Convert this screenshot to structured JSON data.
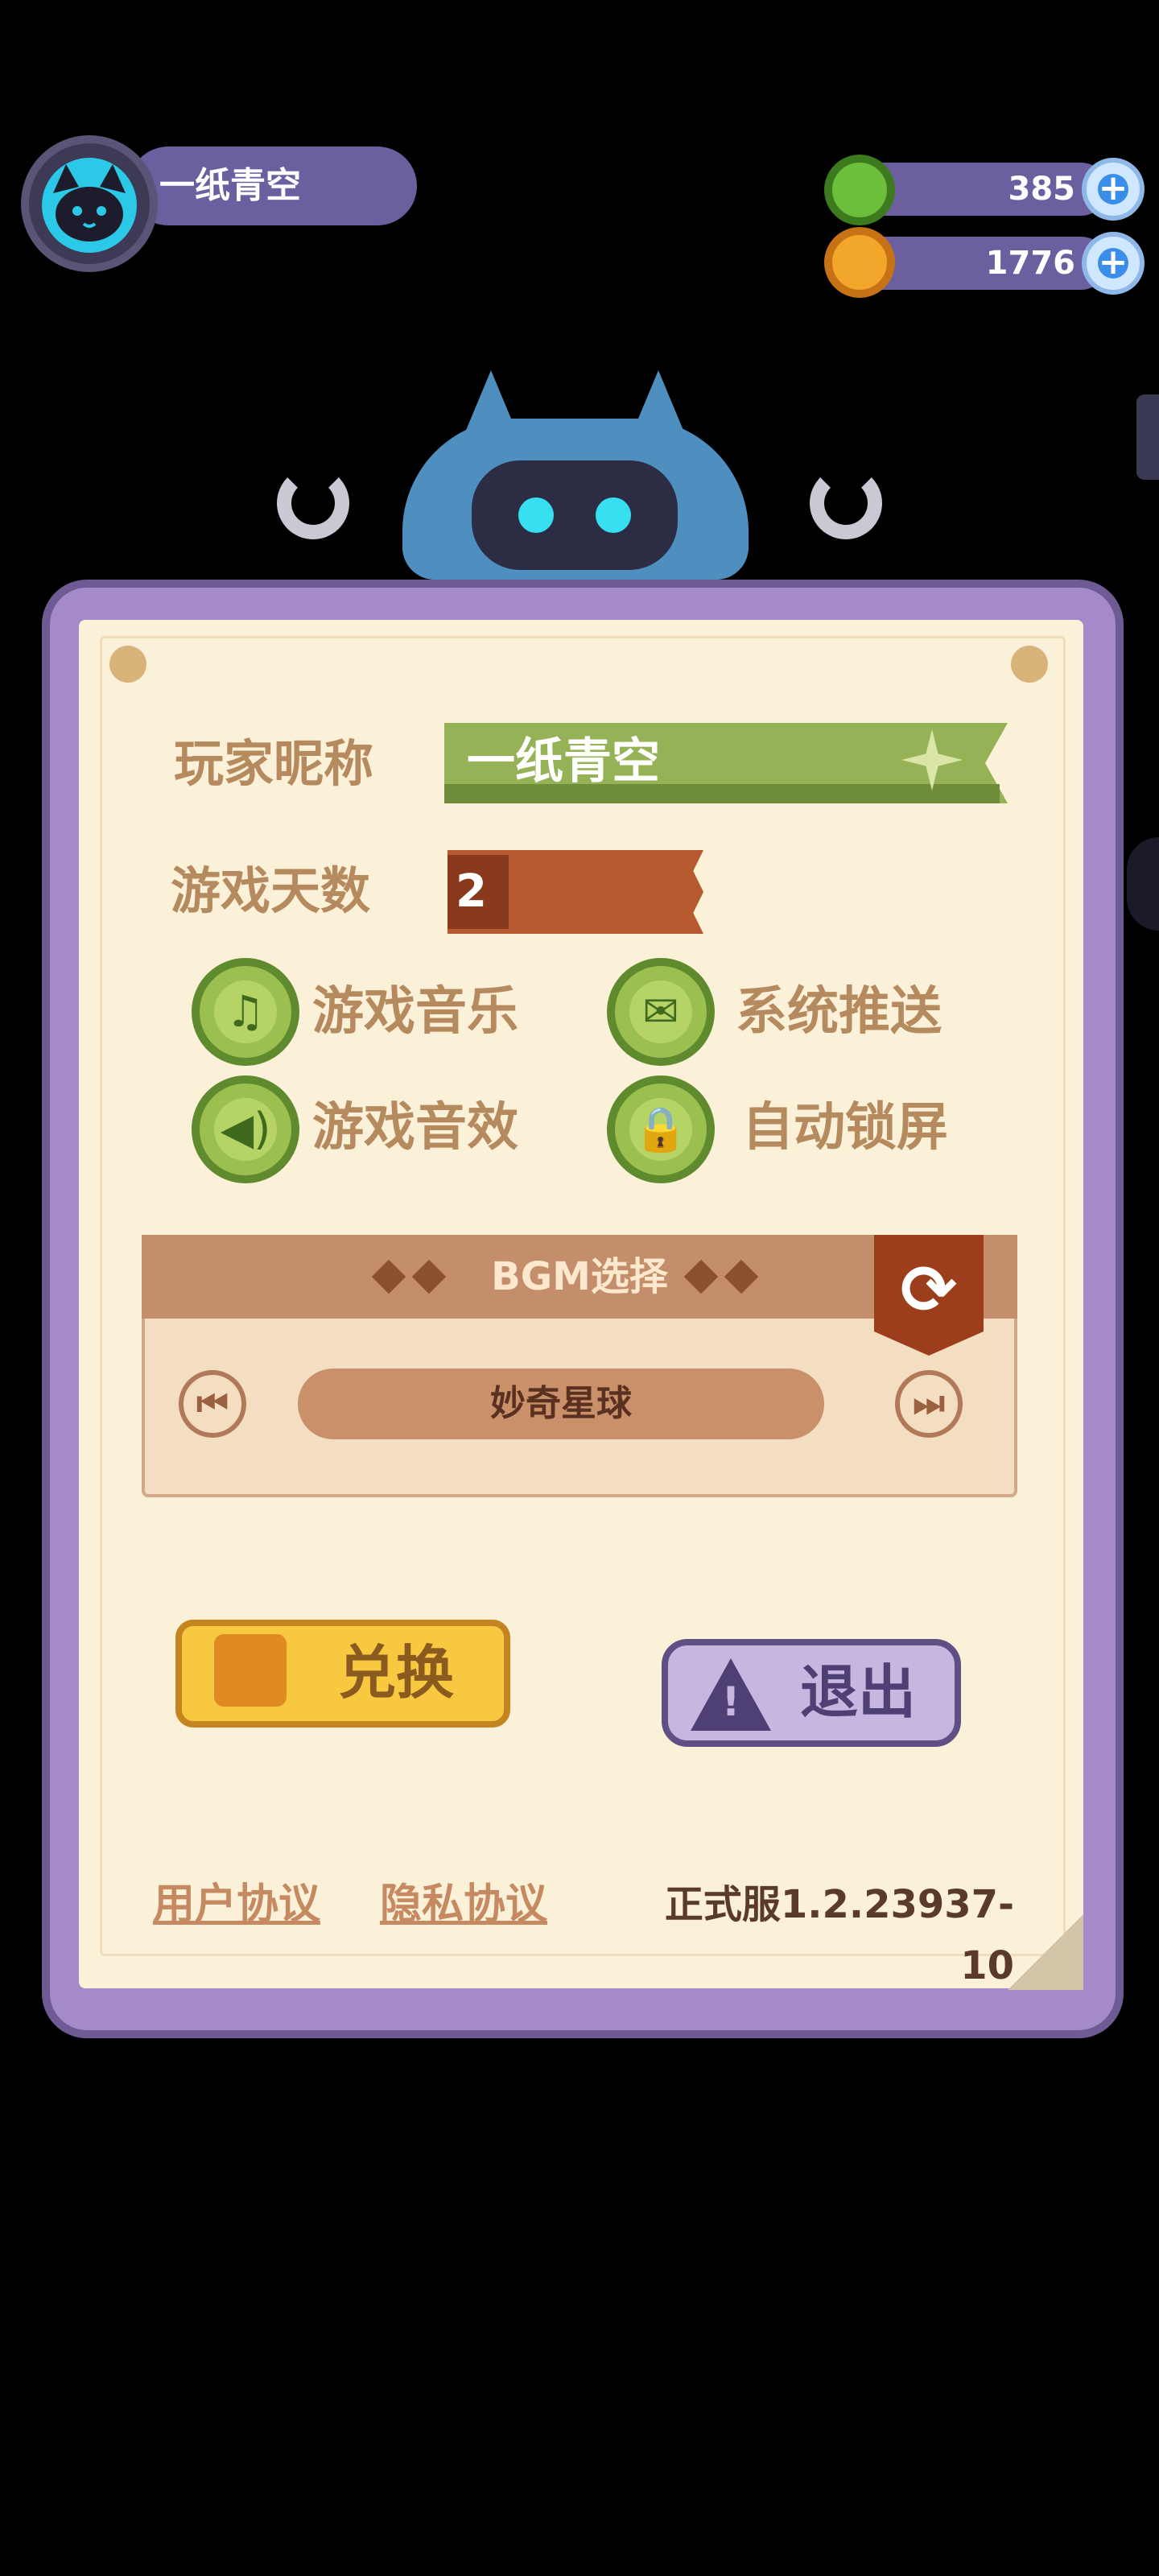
{
  "profile": {
    "name": "一纸青空",
    "avatar": "cat-avatar-icon"
  },
  "currencies": [
    {
      "icon": "donut-coin-icon",
      "value": "385",
      "color": "#6bbf3a"
    },
    {
      "icon": "planet-coin-icon",
      "value": "1776",
      "color": "#f2a72a"
    }
  ],
  "settings": {
    "nickname_label": "玩家昵称",
    "nickname_value": "一纸青空",
    "days_label": "游戏天数",
    "days_value": "2",
    "toggles": [
      {
        "label": "游戏音乐",
        "icon": "music-note-icon"
      },
      {
        "label": "系统推送",
        "icon": "envelope-icon"
      },
      {
        "label": "游戏音效",
        "icon": "speaker-icon"
      },
      {
        "label": "自动锁屏",
        "icon": "lock-icon"
      }
    ]
  },
  "bgm": {
    "title": "BGM选择",
    "track": "妙奇星球",
    "loop_icon": "loop-one-icon",
    "prev_icon": "skip-previous-icon",
    "next_icon": "skip-next-icon"
  },
  "actions": {
    "redeem_label": "兑换",
    "exit_label": "退出"
  },
  "footer": {
    "user_agreement": "用户协议",
    "privacy_agreement": "隐私协议",
    "version": "正式服1.2.23937-10"
  },
  "colors": {
    "panel_frame": "#a48ac8",
    "paper": "#fbf0d8",
    "nickname_banner": "#95b256",
    "days_banner": "#b85a30",
    "label_text": "#b48a5e",
    "redeem_button": "#f8c840",
    "exit_button": "#c7b6e0"
  }
}
